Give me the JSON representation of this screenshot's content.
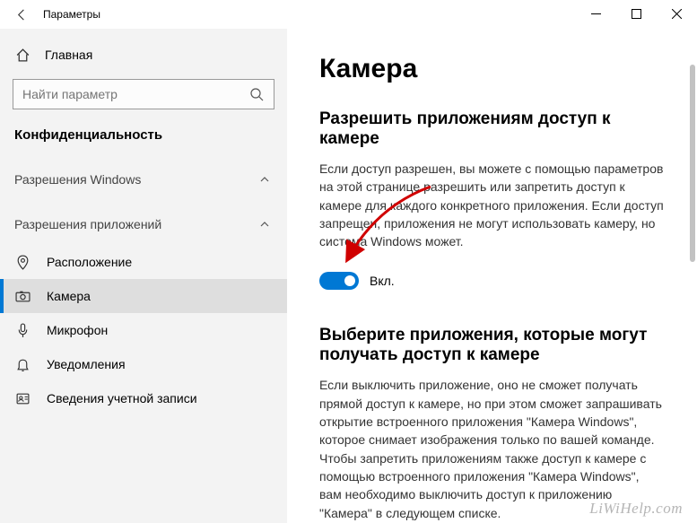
{
  "titlebar": {
    "title": "Параметры"
  },
  "sidebar": {
    "home": "Главная",
    "search_placeholder": "Найти параметр",
    "category": "Конфиденциальность",
    "section_windows": "Разрешения Windows",
    "section_apps": "Разрешения приложений",
    "items": {
      "location": "Расположение",
      "camera": "Камера",
      "microphone": "Микрофон",
      "notifications": "Уведомления",
      "account": "Сведения учетной записи"
    }
  },
  "main": {
    "heading": "Камера",
    "section1_title": "Разрешить приложениям доступ к камере",
    "section1_body": "Если доступ разрешен, вы можете с помощью параметров на этой странице разрешить или запретить доступ к камере для каждого конкретного приложения. Если доступ запрещен, приложения не могут использовать камеру, но система Windows может.",
    "toggle_label": "Вкл.",
    "section2_title": "Выберите приложения, которые могут получать доступ к камере",
    "section2_body": "Если выключить приложение, оно не сможет получать прямой доступ к камере, но при этом сможет запрашивать открытие встроенного приложения \"Камера Windows\", которое снимает изображения только по вашей команде. Чтобы запретить приложениям также доступ к камере с помощью встроенного приложения \"Камера Windows\", вам необходимо выключить доступ к приложению \"Камера\" в следующем списке."
  },
  "watermark": "LiWiHelp.com"
}
